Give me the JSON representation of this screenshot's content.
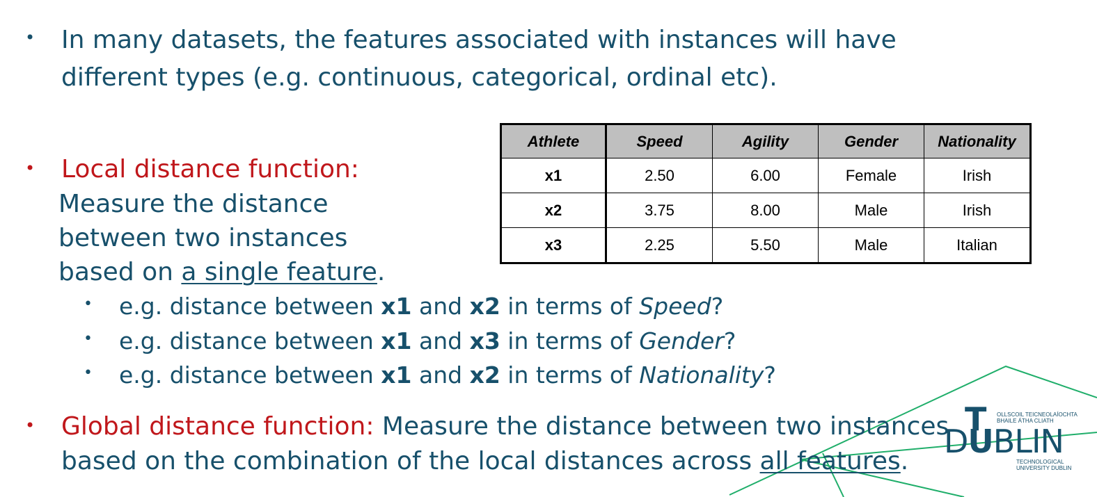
{
  "intro": {
    "line1": "In many datasets, the features associated with instances will have",
    "line2": "different types (e.g. continuous, categorical, ordinal etc)."
  },
  "local": {
    "heading": "Local distance function:",
    "line1": "Measure the distance",
    "line2": "between two instances",
    "line3_prefix": "based on ",
    "line3_underlined": "a single feature",
    "line3_suffix": ".",
    "examples": [
      {
        "pre": "e.g. distance between ",
        "a": "x1",
        "mid": " and ",
        "b": "x2",
        "post": " in terms of ",
        "feature": "Speed",
        "end": "?"
      },
      {
        "pre": "e.g. distance between ",
        "a": "x1",
        "mid": " and ",
        "b": "x3",
        "post": " in terms of ",
        "feature": "Gender",
        "end": "?"
      },
      {
        "pre": "e.g. distance between ",
        "a": "x1",
        "mid": " and ",
        "b": "x2",
        "post": " in terms of ",
        "feature": "Nationality",
        "end": "?"
      }
    ]
  },
  "global": {
    "heading": "Global distance function:",
    "line1_rest": " Measure the distance between two instances",
    "line2_prefix": "based on the combination of the local distances across ",
    "line2_underlined": "all features",
    "line2_suffix": "."
  },
  "bullet_glyph": "•",
  "sub_bullet_glyph": "•",
  "table": {
    "headers": [
      "Athlete",
      "Speed",
      "Agility",
      "Gender",
      "Nationality"
    ],
    "rows": [
      [
        "x1",
        "2.50",
        "6.00",
        "Female",
        "Irish"
      ],
      [
        "x2",
        "3.75",
        "8.00",
        "Male",
        "Irish"
      ],
      [
        "x3",
        "2.25",
        "5.50",
        "Male",
        "Italian"
      ]
    ]
  },
  "logo": {
    "irish_line1": "OLLSCOIL TEICNEOLAÍOCHTA",
    "irish_line2": "BHAILE ÁTHA CLIATH",
    "wordmark_left": "D",
    "wordmark_u": "U",
    "wordmark_right": "BLIN",
    "t_letter": "T",
    "english_line1": "TECHNOLOGICAL",
    "english_line2": "UNIVERSITY DUBLIN"
  },
  "colors": {
    "body_text": "#17506b",
    "heading_red": "#c0171b",
    "decor_green": "#1fae6a",
    "table_header_bg": "#bfbfbf"
  }
}
